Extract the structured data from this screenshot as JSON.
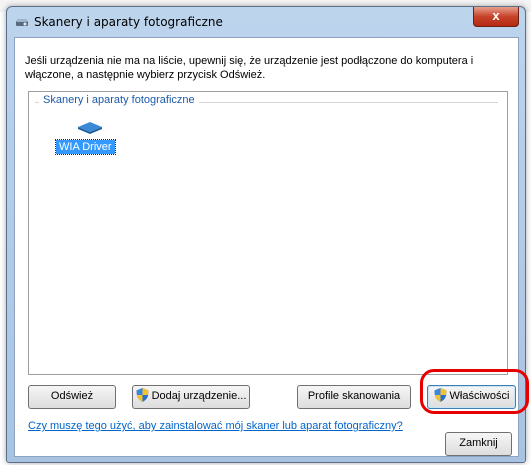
{
  "window": {
    "title": "Skanery i aparaty fotograficzne",
    "close_glyph": "x"
  },
  "intro_text": "Jeśli urządzenia nie ma na liście, upewnij się, że urządzenie jest podłączone do komputera i włączone, a następnie wybierz przycisk Odśwież.",
  "device_group": {
    "label": "Skanery i aparaty fotograficzne",
    "devices": [
      {
        "name": "WIA Driver",
        "icon": "scanner-icon",
        "selected": true
      }
    ]
  },
  "buttons": {
    "refresh": "Odśwież",
    "add_device": "Dodaj urządzenie...",
    "scan_profiles": "Profile skanowania",
    "properties": "Właściwości",
    "close": "Zamknij"
  },
  "help_link": "Czy muszę tego użyć, aby zainstalować mój skaner lub aparat fotograficzny?",
  "colors": {
    "selection": "#3399ff",
    "link": "#0066cc",
    "highlight_ring": "#e60000"
  }
}
